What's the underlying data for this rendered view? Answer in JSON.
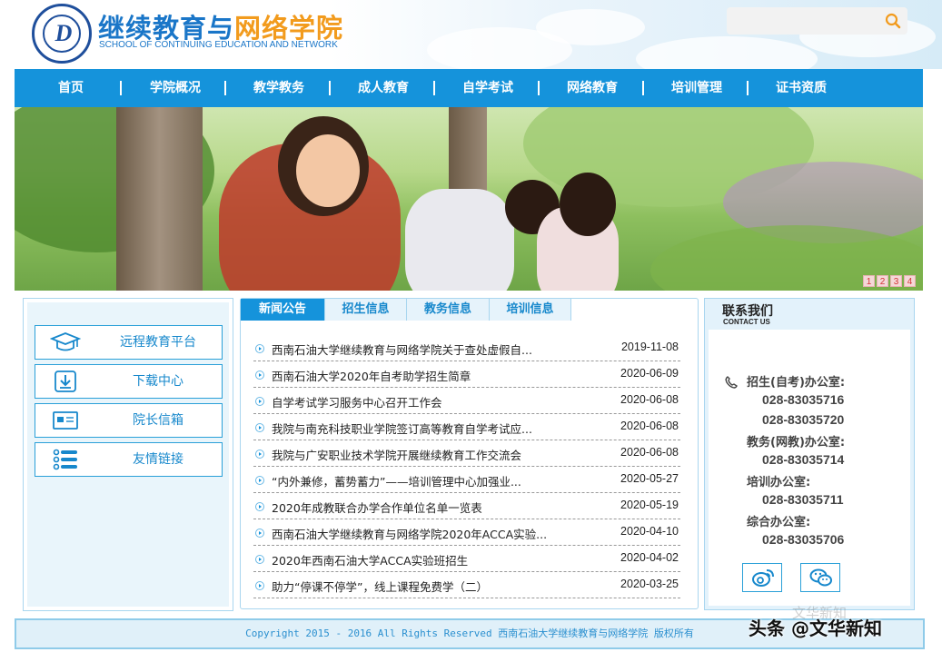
{
  "header": {
    "title_main": "继续教育与",
    "title_accent": "网络学院",
    "subtitle": "SCHOOL OF CONTINUING EDUCATION AND NETWORK",
    "search": {
      "placeholder": ""
    }
  },
  "nav": {
    "items": [
      {
        "label": "首页"
      },
      {
        "label": "学院概况"
      },
      {
        "label": "教学教务"
      },
      {
        "label": "成人教育"
      },
      {
        "label": "自学考试"
      },
      {
        "label": "网络教育"
      },
      {
        "label": "培训管理"
      },
      {
        "label": "证书资质"
      }
    ]
  },
  "banner": {
    "pager": [
      "1",
      "2",
      "3",
      "4"
    ]
  },
  "quick_links": [
    {
      "label": "远程教育平台",
      "icon": "graduation-cap-icon"
    },
    {
      "label": "下载中心",
      "icon": "download-icon"
    },
    {
      "label": "院长信箱",
      "icon": "mailbox-icon"
    },
    {
      "label": "友情链接",
      "icon": "link-list-icon"
    }
  ],
  "news": {
    "tabs": [
      {
        "label": "新闻公告",
        "active": true
      },
      {
        "label": "招生信息",
        "active": false
      },
      {
        "label": "教务信息",
        "active": false
      },
      {
        "label": "培训信息",
        "active": false
      }
    ],
    "items": [
      {
        "title": "西南石油大学继续教育与网络学院关于查处虚假自...",
        "date": "2019-11-08"
      },
      {
        "title": "西南石油大学2020年自考助学招生简章",
        "date": "2020-06-09"
      },
      {
        "title": "自学考试学习服务中心召开工作会",
        "date": "2020-06-08"
      },
      {
        "title": "我院与南充科技职业学院签订高等教育自学考试应...",
        "date": "2020-06-08"
      },
      {
        "title": "我院与广安职业技术学院开展继续教育工作交流会",
        "date": "2020-06-08"
      },
      {
        "title": "“内外兼修，蓄势蓄力”——培训管理中心加强业...",
        "date": "2020-05-27"
      },
      {
        "title": "2020年成教联合办学合作单位名单一览表",
        "date": "2020-05-19"
      },
      {
        "title": "西南石油大学继续教育与网络学院2020年ACCA实验...",
        "date": "2020-04-10"
      },
      {
        "title": "2020年西南石油大学ACCA实验班招生",
        "date": "2020-04-02"
      },
      {
        "title": "助力“停课不停学”，线上课程免费学（二）",
        "date": "2020-03-25"
      }
    ]
  },
  "contact": {
    "title": "联系我们",
    "subtitle": "CONTACT US",
    "offices": [
      {
        "label": "招生(自考)办公室:",
        "numbers": [
          "028-83035716",
          "028-83035720"
        ]
      },
      {
        "label": "教务(网教)办公室:",
        "numbers": [
          "028-83035714"
        ]
      },
      {
        "label": "培训办公室:",
        "numbers": [
          "028-83035711"
        ]
      },
      {
        "label": "综合办公室:",
        "numbers": [
          "028-83035706"
        ]
      }
    ],
    "social": [
      "weibo-icon",
      "wechat-icon"
    ]
  },
  "footer": {
    "text": "Copyright  2015 - 2016 All Rights Reserved 西南石油大学继续教育与网络学院 版权所有"
  },
  "watermark": {
    "text": "头条 @文华新知",
    "faint": "文华新知"
  },
  "colors": {
    "primary": "#1593db",
    "title_blue": "#1a76c8",
    "accent_orange": "#f29b1d",
    "border_light": "#a9d6ef"
  }
}
